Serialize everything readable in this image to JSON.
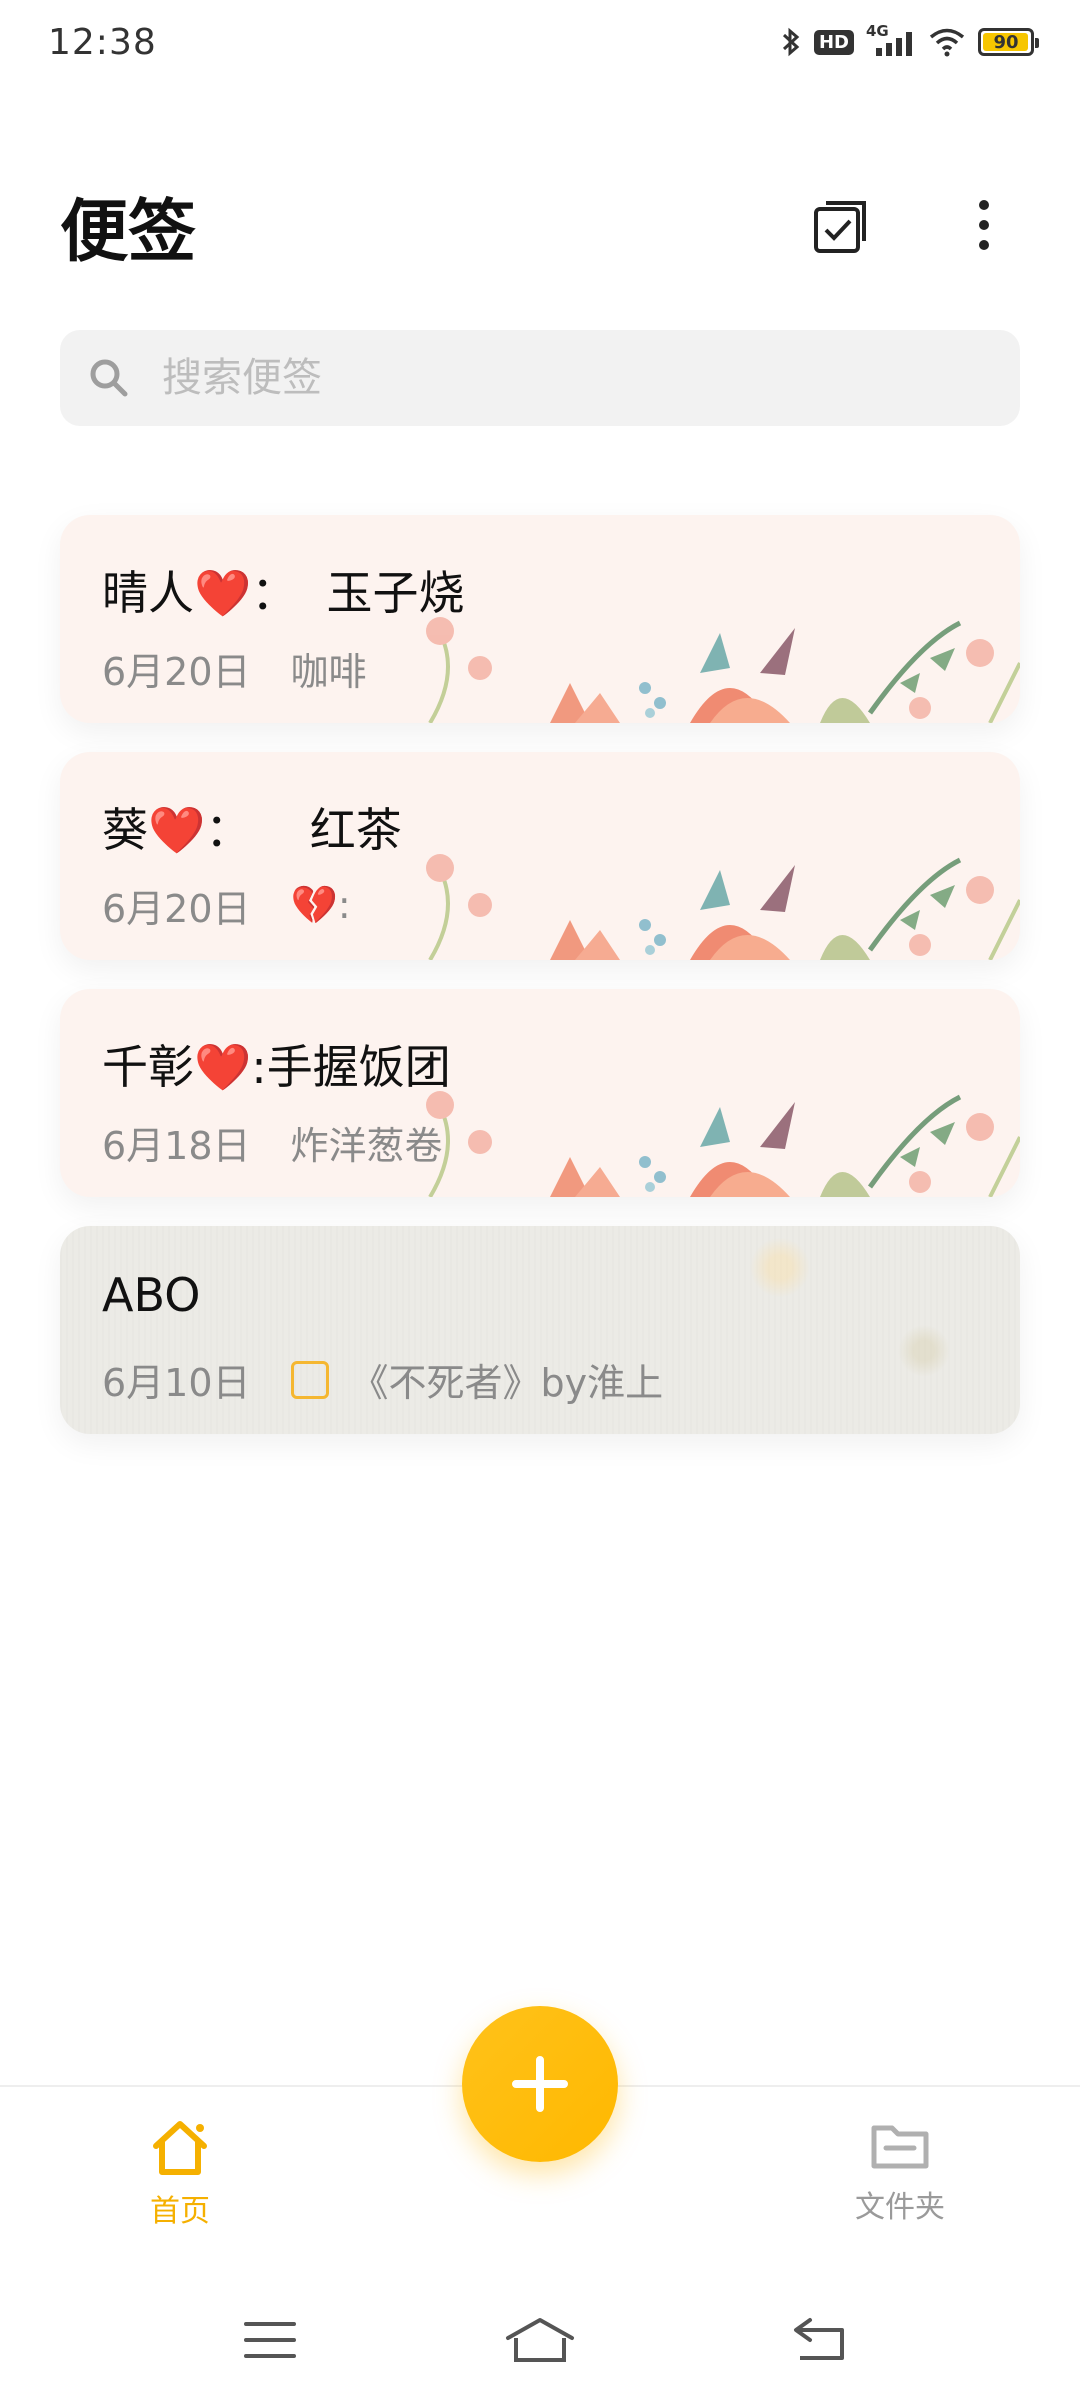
{
  "status_bar": {
    "time": "12:38",
    "network": "4G",
    "hd": "HD",
    "battery": "90",
    "icons": [
      "bluetooth-icon",
      "hd-icon",
      "signal-icon",
      "wifi-icon",
      "battery-icon"
    ]
  },
  "header": {
    "title": "便签",
    "actions": [
      "multi-select-icon",
      "more-icon"
    ]
  },
  "search": {
    "placeholder": "搜索便签",
    "value": ""
  },
  "notes": [
    {
      "title": "晴人❤️：  玉子烧",
      "date": "6月20日",
      "preview": "咖啡",
      "background": "floral"
    },
    {
      "title": "葵❤️：    红茶",
      "date": "6月20日",
      "preview": "💔:",
      "background": "floral"
    },
    {
      "title": "千彰❤️:手握饭团",
      "date": "6月18日",
      "preview": "炸洋葱卷",
      "background": "floral"
    },
    {
      "title": "ABO",
      "date": "6月10日",
      "preview": "《不死者》by淮上",
      "background": "paper",
      "has_checkbox": true
    }
  ],
  "bottom_nav": {
    "home_label": "首页",
    "folder_label": "文件夹",
    "active": "home"
  },
  "colors": {
    "accent": "#ffb800",
    "floral_card": "#fdf3ef",
    "paper_card": "#ecebe6"
  }
}
